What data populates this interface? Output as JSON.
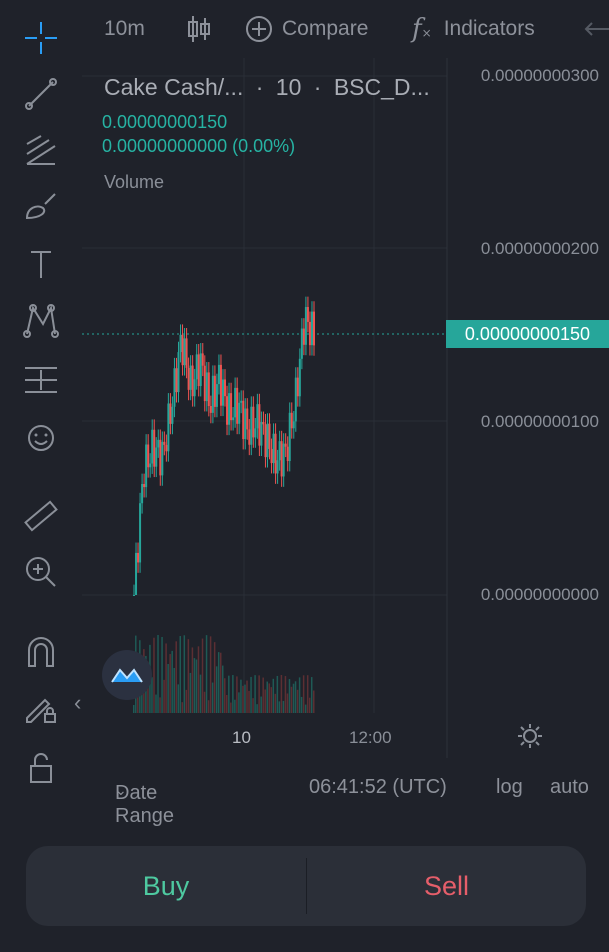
{
  "toolbar": {
    "tools": [
      "crosshair-icon",
      "trend-line-icon",
      "fib-icon",
      "brush-icon",
      "text-icon",
      "pattern-icon",
      "measure-lines-icon",
      "emoji-icon",
      "ruler-icon",
      "zoom-in-icon",
      "magnet-icon",
      "lock-pencil-icon",
      "unlock-icon"
    ],
    "collapse_glyph": "‹"
  },
  "topbar": {
    "interval": "10m",
    "compare_label": "Compare",
    "indicators_label": "Indicators",
    "fx_glyph": "f"
  },
  "chart": {
    "symbol": "Cake Cash/...",
    "sep": "·",
    "interval": "10",
    "exchange": "BSC_D...",
    "last_price": "0.00000000150",
    "change": "0.00000000000 (0.00%)",
    "volume_label": "Volume",
    "price_ticks": [
      "0.00000000300",
      "0.00000000200",
      "0.00000000100",
      "0.00000000000"
    ],
    "current_price_badge": "0.00000000150",
    "time_ticks": [
      "10",
      "12:00"
    ],
    "up_color": "#26a69a",
    "down_color": "#ef5350"
  },
  "chart_data": {
    "type": "candlestick",
    "ylim": [
      0,
      3e-09
    ],
    "x_ticks": [
      "10",
      "12:00"
    ],
    "note": "price series approximated from candles",
    "values": [
      0.0,
      7.2e-10,
      8.5e-10,
      8e-10,
      1.1e-09,
      1.48e-09,
      1.2e-09,
      1.35e-09,
      1.1e-09,
      1.25e-09,
      1.05e-09,
      1.1e-09,
      9.5e-10,
      1e-09,
      9e-10,
      7.8e-10,
      8.2e-10,
      1.1e-09,
      1.6e-09,
      1.5e-09
    ]
  },
  "footer": {
    "date_range": "Date Range",
    "time": "06:41:52 (UTC)",
    "log": "log",
    "auto": "auto"
  },
  "trade": {
    "buy": "Buy",
    "sell": "Sell",
    "buy_color": "#4ec9a0",
    "sell_color": "#e55e6a"
  }
}
